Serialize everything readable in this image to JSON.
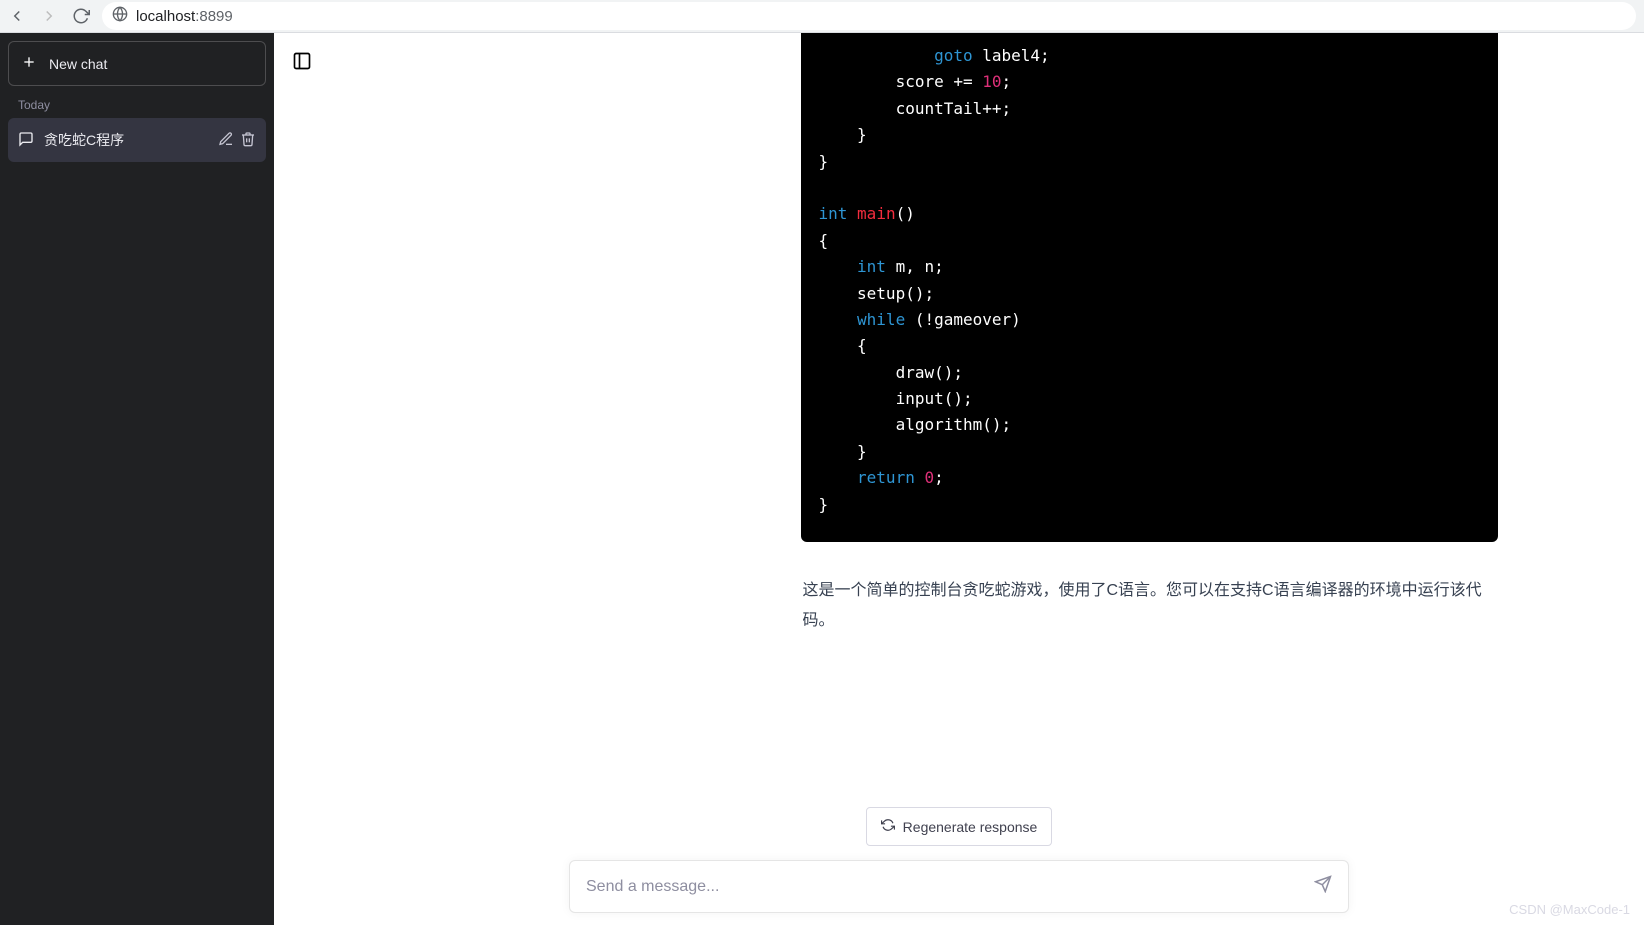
{
  "browser": {
    "url_host": "localhost",
    "url_port": ":8899"
  },
  "sidebar": {
    "new_chat": "New chat",
    "today_label": "Today",
    "items": [
      {
        "label": "贪吃蛇C程序"
      }
    ]
  },
  "code": {
    "tokens": [
      {
        "t": "            ",
        "c": ""
      },
      {
        "t": "goto",
        "c": "kw"
      },
      {
        "t": " label4;\n",
        "c": ""
      },
      {
        "t": "        score += ",
        "c": ""
      },
      {
        "t": "10",
        "c": "num"
      },
      {
        "t": ";\n",
        "c": ""
      },
      {
        "t": "        countTail++;\n",
        "c": ""
      },
      {
        "t": "    }\n",
        "c": ""
      },
      {
        "t": "}\n",
        "c": ""
      },
      {
        "t": "\n",
        "c": ""
      },
      {
        "t": "int",
        "c": "type"
      },
      {
        "t": " ",
        "c": ""
      },
      {
        "t": "main",
        "c": "fn"
      },
      {
        "t": "()\n",
        "c": ""
      },
      {
        "t": "{\n",
        "c": ""
      },
      {
        "t": "    ",
        "c": ""
      },
      {
        "t": "int",
        "c": "type"
      },
      {
        "t": " m, n;\n",
        "c": ""
      },
      {
        "t": "    setup();\n",
        "c": ""
      },
      {
        "t": "    ",
        "c": ""
      },
      {
        "t": "while",
        "c": "kw"
      },
      {
        "t": " (!gameover)\n",
        "c": ""
      },
      {
        "t": "    {\n",
        "c": ""
      },
      {
        "t": "        draw();\n",
        "c": ""
      },
      {
        "t": "        input();\n",
        "c": ""
      },
      {
        "t": "        algorithm();\n",
        "c": ""
      },
      {
        "t": "    }\n",
        "c": ""
      },
      {
        "t": "    ",
        "c": ""
      },
      {
        "t": "return",
        "c": "kw"
      },
      {
        "t": " ",
        "c": ""
      },
      {
        "t": "0",
        "c": "num"
      },
      {
        "t": ";\n",
        "c": ""
      },
      {
        "t": "}",
        "c": ""
      }
    ]
  },
  "paragraph": "这是一个简单的控制台贪吃蛇游戏，使用了C语言。您可以在支持C语言编译器的环境中运行该代码。",
  "regen_label": "Regenerate response",
  "input_placeholder": "Send a message...",
  "watermark": "CSDN @MaxCode-1"
}
